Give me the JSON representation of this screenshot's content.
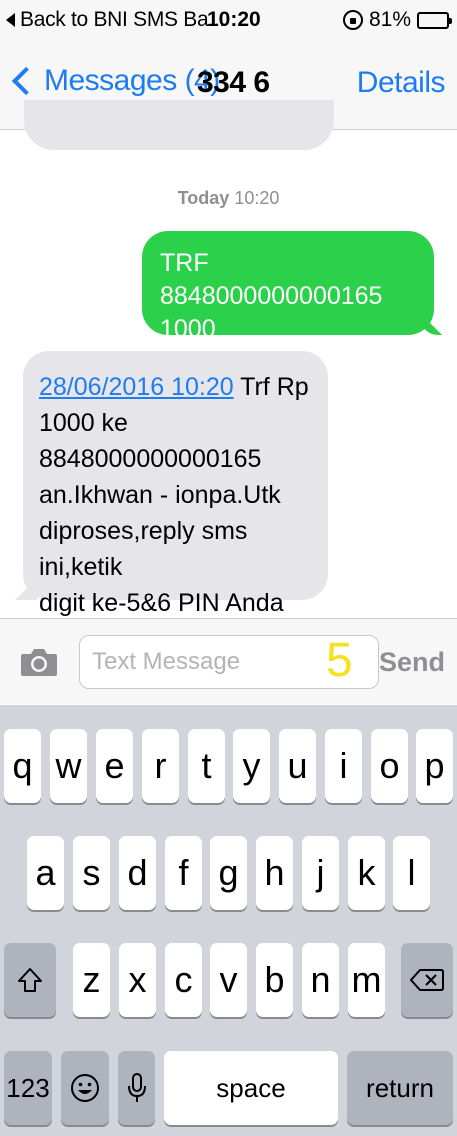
{
  "status_bar": {
    "back_text": "Back to BNI SMS Ba...",
    "time": "10:20",
    "battery_percent": "81%",
    "battery_level": 0.81
  },
  "nav": {
    "back_label": "Messages (4)",
    "title": "334 6",
    "details_label": "Details"
  },
  "timestamp": {
    "day": "Today",
    "time": "10:20"
  },
  "messages": [
    {
      "direction": "outgoing",
      "lines": [
        "TRF 8848000000000165",
        "1000"
      ]
    },
    {
      "direction": "incoming",
      "link_text": "28/06/2016 10:20",
      "lines_after_link": " Trf Rp",
      "lines": [
        "1000 ke",
        "8848000000000165",
        "an.Ikhwan - ionpa.Utk",
        "diproses,reply sms ini,ketik",
        "digit ke-5&6 PIN Anda"
      ]
    }
  ],
  "input_bar": {
    "placeholder": "Text Message",
    "value": "",
    "send_label": "Send",
    "overlay_number": "5"
  },
  "keyboard": {
    "row1": [
      "q",
      "w",
      "e",
      "r",
      "t",
      "y",
      "u",
      "i",
      "o",
      "p"
    ],
    "row2": [
      "a",
      "s",
      "d",
      "f",
      "g",
      "h",
      "j",
      "k",
      "l"
    ],
    "row3": [
      "z",
      "x",
      "c",
      "v",
      "b",
      "n",
      "m"
    ],
    "numbers_label": "123",
    "space_label": "space",
    "return_label": "return"
  },
  "colors": {
    "accent": "#1e7cf2",
    "outgoing_bubble": "#2bd14b",
    "incoming_bubble": "#e5e5ea",
    "overlay_yellow": "#f6e020"
  }
}
